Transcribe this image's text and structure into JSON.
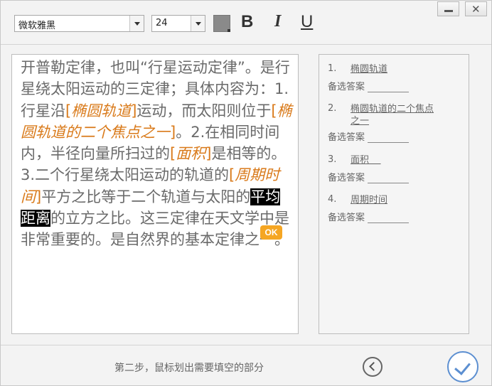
{
  "toolbar": {
    "font_family": "微软雅黑",
    "font_size": "24",
    "text_color": "#8a8a8a",
    "bold_label": "B",
    "italic_label": "I",
    "underline_label": "U"
  },
  "window": {
    "minimize_icon": "minimize-icon",
    "close_icon": "close-icon",
    "close_glyph": "✕"
  },
  "editor": {
    "t1": "开普勒定律，也叫“行星运动定律”。是行星绕太阳运动的三定律；具体内容为：1.行星沿",
    "b1": "椭圆轨道",
    "t2": "运动，而太阳则位于",
    "b2": "椭圆轨道的二个焦点之一",
    "t3": "。2.在相同时间内，半径向量所扫过的",
    "b3": "面积",
    "t4": "是相等的。3.二个行星绕太阳运动的轨道的",
    "b4": "周期时间",
    "t5": "平方之比等于二个轨道与太阳的",
    "sel": "平均距离",
    "t6": "的立方之比。这三定律在天文学中是非常重要的。是自然界的基本定律之一。",
    "ok_label": "OK",
    "blank_color": "#d97a1a"
  },
  "answers": {
    "alt_label": "备选答案",
    "items": [
      {
        "num": "1.",
        "term": "椭圆轨道"
      },
      {
        "num": "2.",
        "term": "椭圆轨道的二个焦点\n之一"
      },
      {
        "num": "3.",
        "term": "面积    "
      },
      {
        "num": "4.",
        "term": "周期时间"
      }
    ]
  },
  "footer": {
    "hint": "第二步，鼠标划出需要填空的部分",
    "confirm_color": "#5c8fd1"
  }
}
